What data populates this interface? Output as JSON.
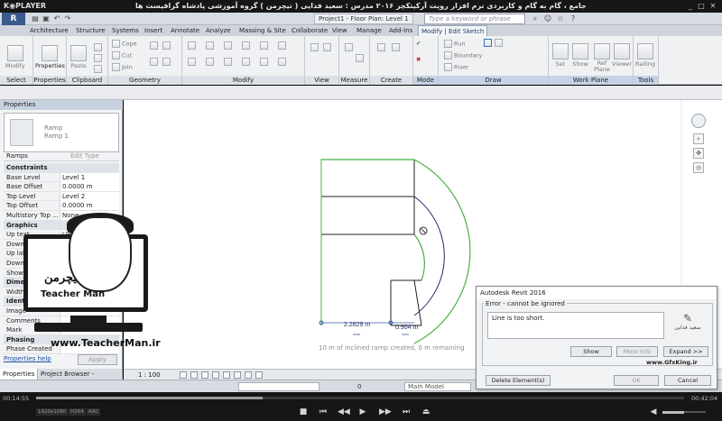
{
  "player": {
    "logo": "K◉PLAYER",
    "title": "مجموعه آموزشی جامع ، گام به گام و کاربردی نرم افزار رویت آرکیتکچر ۲۰۱۶ مدرس : سعید فدایی ( تیچرمن ) گروه آموزشی پادشاه گرافیست ها",
    "elapsed": "00:14:55",
    "total": "00:42:04",
    "progress_fraction": 0.35,
    "volume_fraction": 0.5,
    "tags": [
      "1920x1080",
      "H264",
      "AAC"
    ]
  },
  "qat": {
    "app_letter": "R",
    "doc_title": "Project1 - Floor Plan: Level 1",
    "search_placeholder": "Type a keyword or phrase"
  },
  "ribbon": {
    "tabs": [
      "Architecture",
      "Structure",
      "Systems",
      "Insert",
      "Annotate",
      "Analyze",
      "Massing & Site",
      "Collaborate",
      "View",
      "Manage",
      "Add-Ins",
      "Modify | Edit Sketch"
    ],
    "panels": [
      "Select",
      "Properties",
      "Clipboard",
      "Geometry",
      "Modify",
      "View",
      "Measure",
      "Create",
      "Mode",
      "Draw",
      "Work Plane",
      "Tools"
    ],
    "buttons": {
      "modify": "Modify",
      "properties": "Properties",
      "paste": "Paste",
      "cope": "Cope",
      "cut": "Cut",
      "join": "Join",
      "run": "Run",
      "boundary": "Boundary",
      "riser": "Riser",
      "set": "Set",
      "show": "Show",
      "ref_plane": "Ref Plane",
      "viewer": "Viewer",
      "railing": "Railing"
    }
  },
  "properties": {
    "header": "Properties",
    "type_family": "Ramp",
    "type_name": "Ramp 1",
    "selector": "Ramps",
    "edit_type": "Edit Type",
    "rows": [
      {
        "group": "Constraints"
      },
      {
        "k": "Base Level",
        "v": "Level 1"
      },
      {
        "k": "Base Offset",
        "v": "0.0000 m"
      },
      {
        "k": "Top Level",
        "v": "Level 2"
      },
      {
        "k": "Top Offset",
        "v": "0.0000 m"
      },
      {
        "k": "Multistory Top ...",
        "v": "None"
      },
      {
        "group": "Graphics"
      },
      {
        "k": "Up text",
        "v": "UP"
      },
      {
        "k": "Down text",
        "v": "DN"
      },
      {
        "k": "Up label",
        "v": ""
      },
      {
        "k": "Down label",
        "v": ""
      },
      {
        "k": "Show Up arrow",
        "v": ""
      },
      {
        "group": "Dimensions"
      },
      {
        "k": "Width",
        "v": ""
      },
      {
        "group": "Identity Data"
      },
      {
        "k": "Image",
        "v": ""
      },
      {
        "k": "Comments",
        "v": ""
      },
      {
        "k": "Mark",
        "v": ""
      },
      {
        "group": "Phasing"
      },
      {
        "k": "Phase Created",
        "v": ""
      }
    ],
    "help": "Properties help",
    "apply": "Apply",
    "tabs": [
      "Properties",
      "Project Browser - Project1"
    ]
  },
  "canvas": {
    "dim1": "2.2829 m",
    "dim2": "0.904 m",
    "hint": "10 m of inclined ramp created, 0 m remaining"
  },
  "viewbar": {
    "scale": "1 : 100"
  },
  "status": {
    "model": "Main Model",
    "workset": "0"
  },
  "dialog": {
    "title": "Autodesk Revit 2016",
    "severity": "Error - cannot be ignored",
    "message": "Line is too short.",
    "show": "Show",
    "more_info": "More Info",
    "expand": "Expand >>",
    "delete": "Delete Element(s)",
    "ok": "OK",
    "cancel": "Cancel",
    "watermark_name": "سعید فدایی",
    "watermark_site": "www.GfxKing.ir"
  },
  "watermark": {
    "logo_fa": "تیچرمن",
    "logo_en": "Teacher Man",
    "site": "www.TeacherMan.ir"
  },
  "colors": {
    "ramp_outline": "#1f2a6b",
    "ramp_boundary": "#48b043",
    "sketch_black": "#222222",
    "context_tab": "#1d3c6a"
  }
}
